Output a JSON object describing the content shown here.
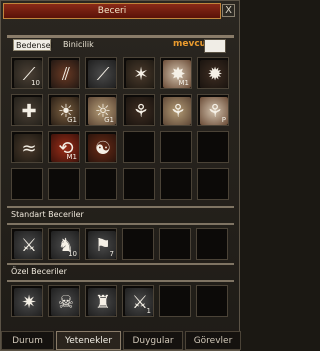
{
  "window": {
    "title": "Beceri",
    "close_label": "X"
  },
  "tabs": [
    {
      "label": "Bedensel"
    },
    {
      "label": "Binicilik"
    }
  ],
  "mevcut_label": "mevcut",
  "sections": {
    "standart": "Standart Beceriler",
    "ozel": "Özel Beceriler"
  },
  "skills": [
    {
      "level": "10",
      "icon": "slash-icon"
    },
    {
      "level": "",
      "icon": "claw-icon"
    },
    {
      "level": "",
      "icon": "spiral-icon"
    },
    {
      "level": "",
      "icon": "burst-icon"
    },
    {
      "level": "M1",
      "icon": "star-icon"
    },
    {
      "level": "",
      "icon": "flame-icon"
    },
    {
      "level": "",
      "icon": "cross-icon"
    },
    {
      "level": "G1",
      "icon": "sun-icon"
    },
    {
      "level": "",
      "icon": "tree-icon"
    },
    {
      "level": "",
      "icon": "tree-icon"
    },
    {
      "level": "P",
      "icon": "tree-icon"
    },
    {
      "level": "",
      "icon": "wave-icon"
    },
    {
      "level": "M1",
      "icon": "vortex-icon"
    },
    {
      "level": "",
      "icon": "yin-icon"
    }
  ],
  "standart_skills": [
    {
      "level": "",
      "icon": "sword-icon"
    },
    {
      "level": "10",
      "icon": "horse-icon"
    },
    {
      "level": "7",
      "icon": "flag-icon"
    }
  ],
  "ozel_skills": [
    {
      "level": "",
      "icon": "spikes-icon"
    },
    {
      "level": "",
      "icon": "skull-icon"
    },
    {
      "level": "",
      "icon": "helmet-icon"
    },
    {
      "level": "1",
      "icon": "swords-icon"
    }
  ],
  "bottom_tabs": [
    "Durum",
    "Yetenekler",
    "Duygular",
    "Görevler"
  ]
}
